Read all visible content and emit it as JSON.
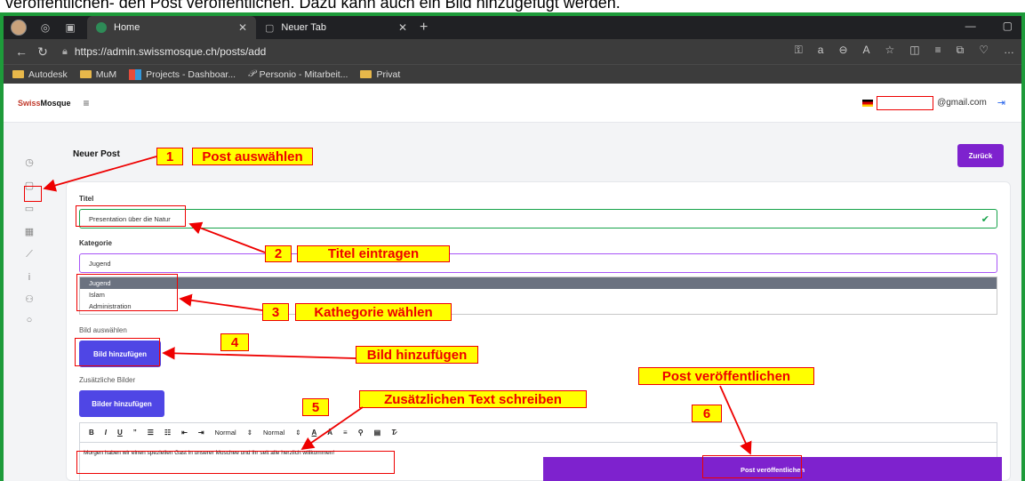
{
  "caption": "veröffentlichen- den Post veröffentlichen. Dazu kann auch ein Bild hinzugefügt werden.",
  "browser": {
    "tabs": [
      {
        "label": "Home",
        "active": true
      },
      {
        "label": "Neuer Tab",
        "active": false
      }
    ],
    "url": "https://admin.swissmosque.ch/posts/add",
    "bookmarks": [
      "Autodesk",
      "MuM",
      "Projects - Dashboar...",
      "Personio - Mitarbeit...",
      "Privat"
    ]
  },
  "app": {
    "brand_red": "Swiss",
    "brand_black": "Mosque",
    "user_email_suffix": "@gmail.com",
    "page_title": "Neuer Post",
    "back_button": "Zurück",
    "form": {
      "title_label": "Titel",
      "title_value": "Presentation über die Natur",
      "category_label": "Kategorie",
      "category_value": "Jugend",
      "category_options": [
        "Jugend",
        "Islam",
        "Administration"
      ],
      "image_label": "Bild auswählen",
      "image_button": "Bild hinzufügen",
      "extra_images_label": "Zusätzliche Bilder",
      "extra_images_button": "Bilder hinzufügen",
      "toolbar": {
        "normal1": "Normal",
        "normal2": "Normal"
      },
      "editor_text": "Morgen haben wir einen speziellen Gast in unserer Moschee und ihr seit alle herzlich willkommen!",
      "publish_button": "Post veröffentlichen"
    }
  },
  "annotations": {
    "n1": "1",
    "t1": "Post auswählen",
    "n2": "2",
    "t2": "Titel eintragen",
    "n3": "3",
    "t3": "Kathegorie wählen",
    "n4": "4",
    "t4": "Bild hinzufügen",
    "n5": "5",
    "t5": "Zusätzlichen Text schreiben",
    "n6": "6",
    "t6": "Post veröffentlichen"
  },
  "colors": {
    "frame_green": "#1e9b3a",
    "accent_purple": "#7e22ce",
    "button_indigo": "#4f46e5",
    "annotation_red": "#e00000",
    "annotation_yellow": "#ffff00"
  }
}
